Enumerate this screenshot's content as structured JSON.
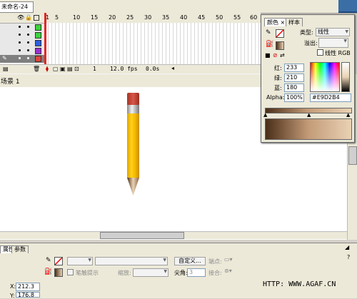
{
  "doc_tab": "未命名-24",
  "timeline": {
    "frame_numbers": [
      "1",
      "5",
      "10",
      "15",
      "20",
      "25",
      "30",
      "35",
      "40",
      "45",
      "50",
      "55",
      "60"
    ],
    "fps": "12.0 fps",
    "current_frame": "1",
    "elapsed": "0.0s"
  },
  "breadcrumb": {
    "scene": "场景 1"
  },
  "color_panel": {
    "tab_color": "颜色",
    "tab_swatches": "样本",
    "type_label": "类型:",
    "type_value": "线性",
    "overflow_label": "溢出:",
    "linear_rgb_label": "线性 RGB",
    "red_label": "红:",
    "red_value": "233",
    "green_label": "绿:",
    "green_value": "210",
    "blue_label": "蓝:",
    "blue_value": "180",
    "alpha_label": "Alpha:",
    "alpha_value": "100%",
    "hex_value": "#E9D2B4",
    "gradient_start": "#4a2e18",
    "gradient_end": "#e9d2b4"
  },
  "properties": {
    "tab_props": "属性",
    "tab_params": "参数",
    "custom_button": "自定义...",
    "endpoint_label": "端点:",
    "hint_label": "笔触提示",
    "scale_label": "缩放:",
    "miter_label": "尖角:",
    "miter_value": "3",
    "join_label": "接合:",
    "x_label": "X:",
    "x_value": "212.3",
    "y_label": "Y:",
    "y_value": "176.8"
  },
  "watermark": "HTTP: WWW.AGAF.CN"
}
